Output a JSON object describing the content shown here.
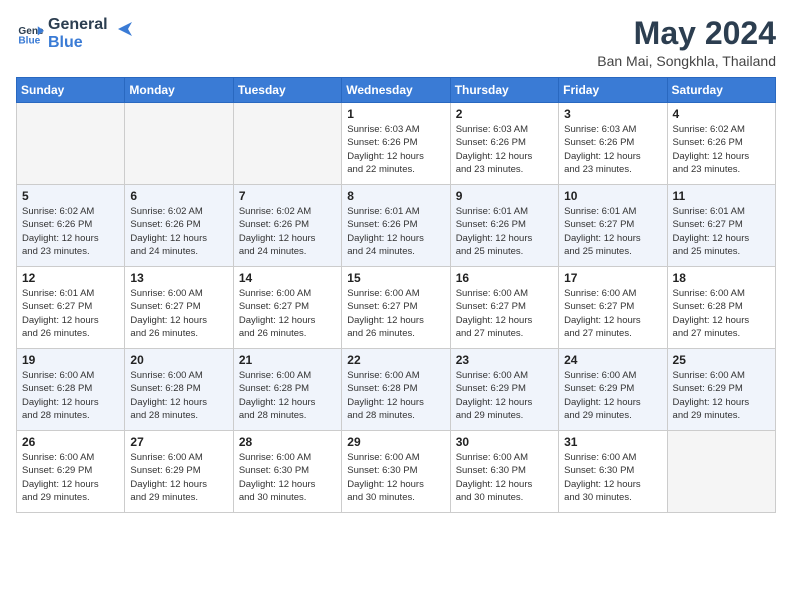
{
  "logo": {
    "line1": "General",
    "line2": "Blue"
  },
  "title": "May 2024",
  "location": "Ban Mai, Songkhla, Thailand",
  "weekdays": [
    "Sunday",
    "Monday",
    "Tuesday",
    "Wednesday",
    "Thursday",
    "Friday",
    "Saturday"
  ],
  "weeks": [
    [
      {
        "day": "",
        "info": ""
      },
      {
        "day": "",
        "info": ""
      },
      {
        "day": "",
        "info": ""
      },
      {
        "day": "1",
        "info": "Sunrise: 6:03 AM\nSunset: 6:26 PM\nDaylight: 12 hours\nand 22 minutes."
      },
      {
        "day": "2",
        "info": "Sunrise: 6:03 AM\nSunset: 6:26 PM\nDaylight: 12 hours\nand 23 minutes."
      },
      {
        "day": "3",
        "info": "Sunrise: 6:03 AM\nSunset: 6:26 PM\nDaylight: 12 hours\nand 23 minutes."
      },
      {
        "day": "4",
        "info": "Sunrise: 6:02 AM\nSunset: 6:26 PM\nDaylight: 12 hours\nand 23 minutes."
      }
    ],
    [
      {
        "day": "5",
        "info": "Sunrise: 6:02 AM\nSunset: 6:26 PM\nDaylight: 12 hours\nand 23 minutes."
      },
      {
        "day": "6",
        "info": "Sunrise: 6:02 AM\nSunset: 6:26 PM\nDaylight: 12 hours\nand 24 minutes."
      },
      {
        "day": "7",
        "info": "Sunrise: 6:02 AM\nSunset: 6:26 PM\nDaylight: 12 hours\nand 24 minutes."
      },
      {
        "day": "8",
        "info": "Sunrise: 6:01 AM\nSunset: 6:26 PM\nDaylight: 12 hours\nand 24 minutes."
      },
      {
        "day": "9",
        "info": "Sunrise: 6:01 AM\nSunset: 6:26 PM\nDaylight: 12 hours\nand 25 minutes."
      },
      {
        "day": "10",
        "info": "Sunrise: 6:01 AM\nSunset: 6:27 PM\nDaylight: 12 hours\nand 25 minutes."
      },
      {
        "day": "11",
        "info": "Sunrise: 6:01 AM\nSunset: 6:27 PM\nDaylight: 12 hours\nand 25 minutes."
      }
    ],
    [
      {
        "day": "12",
        "info": "Sunrise: 6:01 AM\nSunset: 6:27 PM\nDaylight: 12 hours\nand 26 minutes."
      },
      {
        "day": "13",
        "info": "Sunrise: 6:00 AM\nSunset: 6:27 PM\nDaylight: 12 hours\nand 26 minutes."
      },
      {
        "day": "14",
        "info": "Sunrise: 6:00 AM\nSunset: 6:27 PM\nDaylight: 12 hours\nand 26 minutes."
      },
      {
        "day": "15",
        "info": "Sunrise: 6:00 AM\nSunset: 6:27 PM\nDaylight: 12 hours\nand 26 minutes."
      },
      {
        "day": "16",
        "info": "Sunrise: 6:00 AM\nSunset: 6:27 PM\nDaylight: 12 hours\nand 27 minutes."
      },
      {
        "day": "17",
        "info": "Sunrise: 6:00 AM\nSunset: 6:27 PM\nDaylight: 12 hours\nand 27 minutes."
      },
      {
        "day": "18",
        "info": "Sunrise: 6:00 AM\nSunset: 6:28 PM\nDaylight: 12 hours\nand 27 minutes."
      }
    ],
    [
      {
        "day": "19",
        "info": "Sunrise: 6:00 AM\nSunset: 6:28 PM\nDaylight: 12 hours\nand 28 minutes."
      },
      {
        "day": "20",
        "info": "Sunrise: 6:00 AM\nSunset: 6:28 PM\nDaylight: 12 hours\nand 28 minutes."
      },
      {
        "day": "21",
        "info": "Sunrise: 6:00 AM\nSunset: 6:28 PM\nDaylight: 12 hours\nand 28 minutes."
      },
      {
        "day": "22",
        "info": "Sunrise: 6:00 AM\nSunset: 6:28 PM\nDaylight: 12 hours\nand 28 minutes."
      },
      {
        "day": "23",
        "info": "Sunrise: 6:00 AM\nSunset: 6:29 PM\nDaylight: 12 hours\nand 29 minutes."
      },
      {
        "day": "24",
        "info": "Sunrise: 6:00 AM\nSunset: 6:29 PM\nDaylight: 12 hours\nand 29 minutes."
      },
      {
        "day": "25",
        "info": "Sunrise: 6:00 AM\nSunset: 6:29 PM\nDaylight: 12 hours\nand 29 minutes."
      }
    ],
    [
      {
        "day": "26",
        "info": "Sunrise: 6:00 AM\nSunset: 6:29 PM\nDaylight: 12 hours\nand 29 minutes."
      },
      {
        "day": "27",
        "info": "Sunrise: 6:00 AM\nSunset: 6:29 PM\nDaylight: 12 hours\nand 29 minutes."
      },
      {
        "day": "28",
        "info": "Sunrise: 6:00 AM\nSunset: 6:30 PM\nDaylight: 12 hours\nand 30 minutes."
      },
      {
        "day": "29",
        "info": "Sunrise: 6:00 AM\nSunset: 6:30 PM\nDaylight: 12 hours\nand 30 minutes."
      },
      {
        "day": "30",
        "info": "Sunrise: 6:00 AM\nSunset: 6:30 PM\nDaylight: 12 hours\nand 30 minutes."
      },
      {
        "day": "31",
        "info": "Sunrise: 6:00 AM\nSunset: 6:30 PM\nDaylight: 12 hours\nand 30 minutes."
      },
      {
        "day": "",
        "info": ""
      }
    ]
  ],
  "shaded_rows": [
    1,
    3
  ]
}
